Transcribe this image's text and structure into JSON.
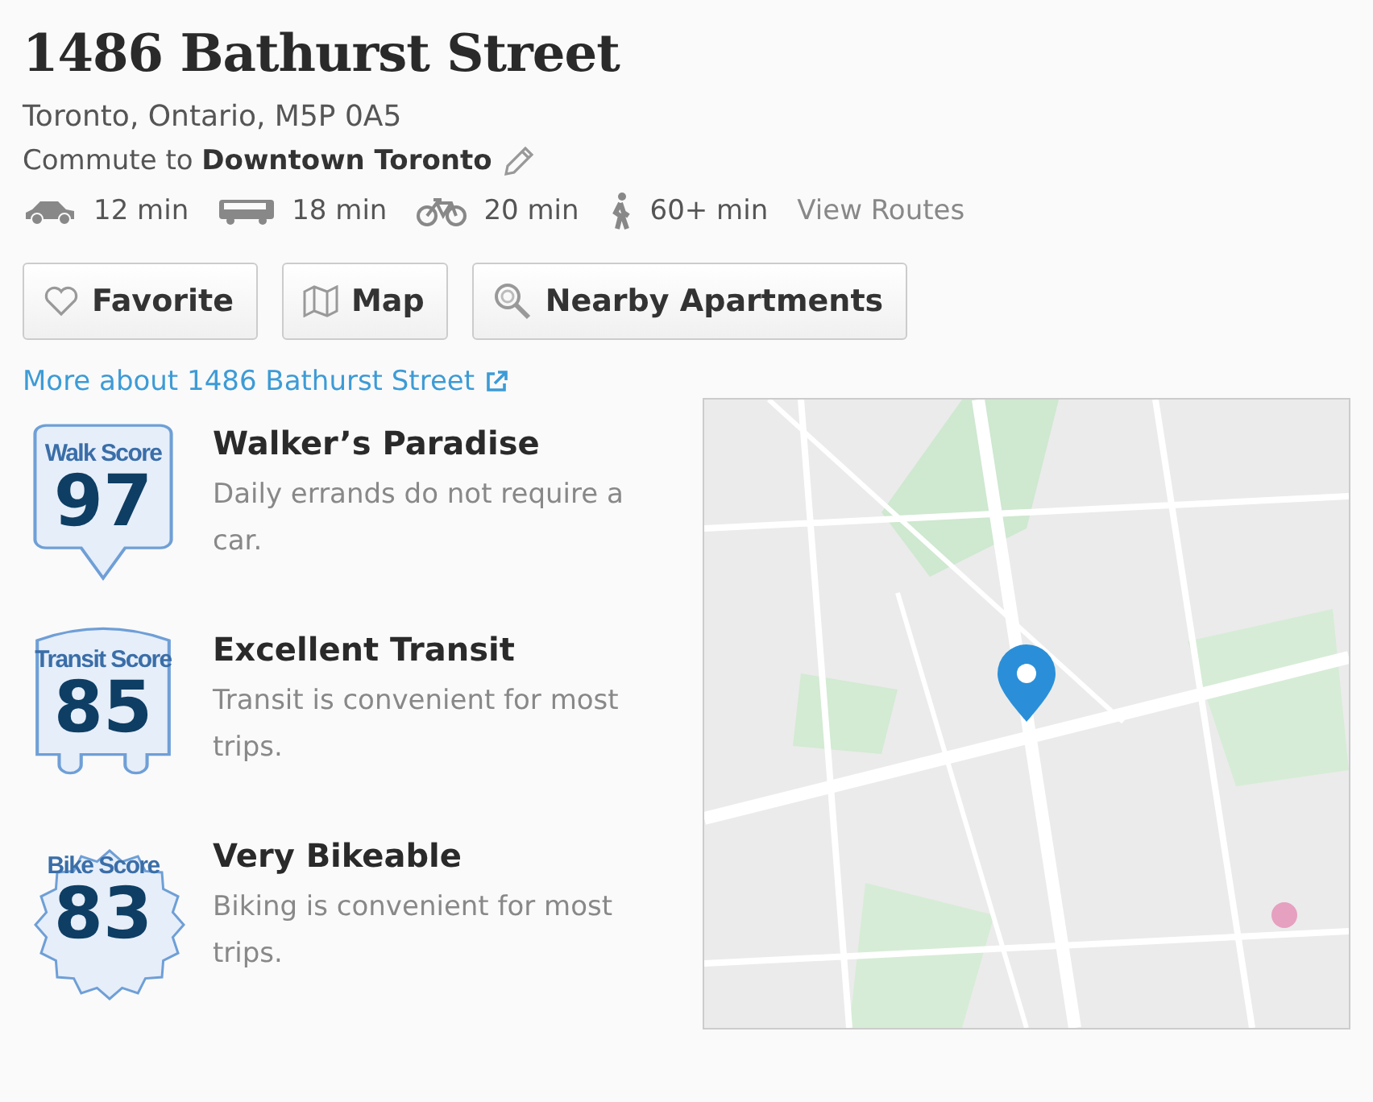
{
  "listing": {
    "title": "1486 Bathurst Street",
    "address": "Toronto, Ontario, M5P 0A5",
    "commute": "Commute to **Downtown Toronto**",
    "modes": [
      {
        "kind": "car",
        "time": "12 min"
      },
      {
        "kind": "bus",
        "time": "18 min"
      },
      {
        "kind": "bike",
        "time": "20 min"
      },
      {
        "kind": "walk",
        "time": "60+ min"
      }
    ],
    "view_routes": "View Routes",
    "buttons": [
      {
        "kind": "favorite",
        "label": "Favorite"
      },
      {
        "kind": "map",
        "label": "Map"
      },
      {
        "kind": "search",
        "label": "Nearby Apartments"
      }
    ],
    "more_link": "More about 1486 Bathurst Street"
  },
  "scores": [
    {
      "kind": "walk",
      "label": "Walk Score",
      "value": "97",
      "title": "Walker’s Paradise",
      "description": "Daily errands do not require a car."
    },
    {
      "kind": "transit",
      "label": "Transit Score",
      "value": "85",
      "title": "Excellent Transit",
      "description": "Transit is convenient for most trips."
    },
    {
      "kind": "bike",
      "label": "Bike Score",
      "value": "83",
      "title": "Very Bikeable",
      "description": "Biking is convenient for most trips."
    }
  ]
}
